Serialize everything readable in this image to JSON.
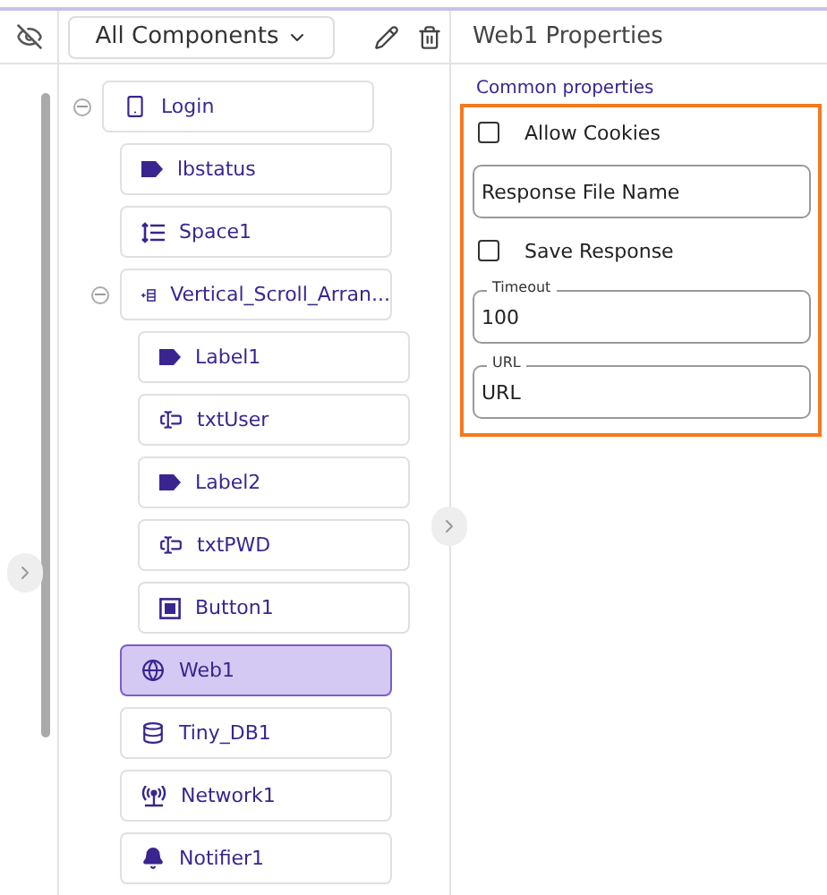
{
  "toolbar": {
    "filter": "All Components"
  },
  "tree": [
    {
      "label": "Login",
      "kind": "screen",
      "selected": false,
      "expanded": true,
      "children": [
        {
          "label": "lbstatus",
          "kind": "label",
          "selected": false
        },
        {
          "label": "Space1",
          "kind": "spacer",
          "selected": false
        },
        {
          "label": "Vertical_Scroll_Arran...",
          "kind": "arrangement",
          "selected": false,
          "expanded": true,
          "children": [
            {
              "label": "Label1",
              "kind": "label",
              "selected": false
            },
            {
              "label": "txtUser",
              "kind": "textbox",
              "selected": false
            },
            {
              "label": "Label2",
              "kind": "label",
              "selected": false
            },
            {
              "label": "txtPWD",
              "kind": "textbox",
              "selected": false
            },
            {
              "label": "Button1",
              "kind": "button",
              "selected": false
            }
          ]
        },
        {
          "label": "Web1",
          "kind": "web",
          "selected": true
        },
        {
          "label": "Tiny_DB1",
          "kind": "database",
          "selected": false
        },
        {
          "label": "Network1",
          "kind": "network",
          "selected": false
        },
        {
          "label": "Notifier1",
          "kind": "notifier",
          "selected": false
        }
      ]
    }
  ],
  "properties": {
    "title": "Web1 Properties",
    "section": "Common properties",
    "items": [
      {
        "kind": "checkbox",
        "label": "Allow Cookies",
        "checked": false
      },
      {
        "kind": "field",
        "placeholder": "Response File Name"
      },
      {
        "kind": "checkbox",
        "label": "Save Response",
        "checked": false
      },
      {
        "kind": "field",
        "label": "Timeout",
        "value": "100"
      },
      {
        "kind": "field",
        "label": "URL",
        "placeholder": "URL"
      }
    ]
  }
}
